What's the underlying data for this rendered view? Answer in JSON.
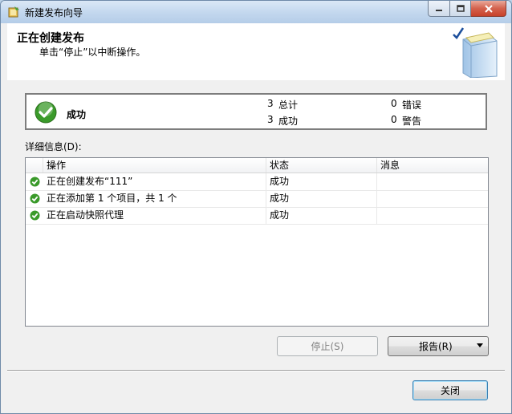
{
  "window": {
    "title": "新建发布向导"
  },
  "header": {
    "title": "正在创建发布",
    "subtitle": "单击“停止”以中断操作。"
  },
  "status": {
    "result": "成功",
    "total_count": "3",
    "total_label": "总计",
    "success_count": "3",
    "success_label": "成功",
    "error_count": "0",
    "error_label": "错误",
    "warning_count": "0",
    "warning_label": "警告"
  },
  "details": {
    "label": "详细信息(D):",
    "columns": [
      "操作",
      "状态",
      "消息"
    ],
    "rows": [
      {
        "action": "正在创建发布“111”",
        "status": "成功",
        "message": ""
      },
      {
        "action": "正在添加第 1 个项目，共 1 个",
        "status": "成功",
        "message": ""
      },
      {
        "action": "正在启动快照代理",
        "status": "成功",
        "message": ""
      }
    ]
  },
  "buttons": {
    "stop": "停止(S)",
    "report": "报告(R)",
    "close": "关闭"
  },
  "colors": {
    "success_green": "#3a9a2a",
    "titlebar": "#c2d7ee",
    "close_red": "#c8412a"
  }
}
